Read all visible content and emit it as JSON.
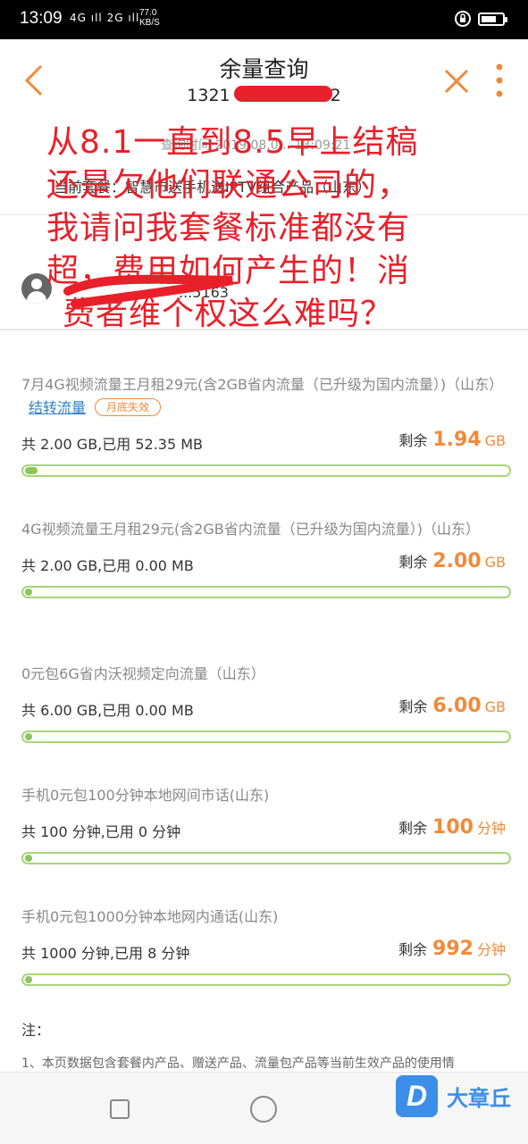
{
  "status_bar": {
    "time": "13:09",
    "signal_text": "4G ıll 2G ıll",
    "net_speed": "77.0",
    "net_unit": "KB/S"
  },
  "header": {
    "title": "余量查询",
    "phone_partial_start": "1321",
    "phone_partial_end": "2",
    "back_icon": "chevron-left-icon",
    "close_icon": "close-icon",
    "more_icon": "more-vertical-icon",
    "accent": "#f08a3a"
  },
  "info": {
    "query_time": "查询时间 2019.08.0... 13:09:21",
    "package_line": "当前套餐：智慧市送手机送IPTV组合产品（山东）",
    "user_tail": "...5163"
  },
  "complaint": {
    "lines": [
      "从8.1一直到8.5早上结稿",
      "还是欠他们联通公司的，",
      "我请问我套餐标准都没有",
      "超，费用如何产生的！消",
      "费者维个权这么难吗？"
    ],
    "color": "#e8202a"
  },
  "items": [
    {
      "name": "7月4G视频流量王月租29元(含2GB省内流量（已升级为国内流量）)（山东）",
      "link": "结转流量",
      "tag": "月底失效",
      "total": "共 2.00 GB,已用 52.35 MB",
      "remain_label": "剩余",
      "remain_value": "1.94",
      "remain_unit": "GB",
      "used_fraction": 0.026
    },
    {
      "name": "4G视频流量王月租29元(含2GB省内流量（已升级为国内流量）)（山东）",
      "total": "共 2.00 GB,已用 0.00 MB",
      "remain_label": "剩余",
      "remain_value": "2.00",
      "remain_unit": "GB",
      "used_fraction": 0.0
    },
    {
      "name": "0元包6G省内沃视频定向流量（山东）",
      "total": "共 6.00 GB,已用 0.00 MB",
      "remain_label": "剩余",
      "remain_value": "6.00",
      "remain_unit": "GB",
      "used_fraction": 0.0
    },
    {
      "name": "手机0元包100分钟本地网间市话(山东)",
      "total": "共 100 分钟,已用 0 分钟",
      "remain_label": "剩余",
      "remain_value": "100",
      "remain_unit": "分钟",
      "used_fraction": 0.0
    },
    {
      "name": "手机0元包1000分钟本地网内通话(山东)",
      "total": "共 1000 分钟,已用 8 分钟",
      "remain_label": "剩余",
      "remain_value": "992",
      "remain_unit": "分钟",
      "used_fraction": 0.008
    }
  ],
  "note": {
    "title": "注：",
    "text": "1、本页数据包含套餐内产品、赠送产品、流量包产品等当前生效产品的使用情"
  },
  "watermark": {
    "logo_letter": "D",
    "text": "大章丘"
  }
}
